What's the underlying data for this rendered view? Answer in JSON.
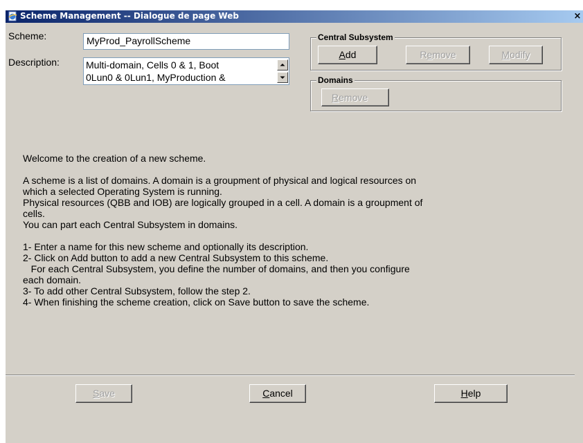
{
  "window": {
    "title": "Scheme Management -- Dialogue de page Web",
    "close_glyph": "×"
  },
  "form": {
    "scheme_label": "Scheme:",
    "scheme_value": "MyProd_PayrollScheme",
    "description_label": "Description:",
    "description_line1": "Multi-domain, Cells 0 & 1, Boot",
    "description_line2": "0Lun0 & 0Lun1, MyProduction &"
  },
  "central_subsystem": {
    "title": "Central Subsystem",
    "add_accel": "A",
    "add_rest": "dd",
    "remove_pre": "R",
    "remove_accel": "e",
    "remove_rest": "move",
    "modify_accel": "M",
    "modify_rest": "odify"
  },
  "domains": {
    "title": "Domains",
    "remove_accel": "R",
    "remove_rest": "emove"
  },
  "intro": {
    "welcome": "Welcome to the creation of a new scheme.",
    "p1": "A scheme is a list of domains. A domain is a groupment of physical and logical resources on",
    "p2": "which a selected Operating System is running.",
    "p3": "Physical resources (QBB and IOB) are logically grouped in a cell. A domain is a groupment of",
    "p4": "cells.",
    "p5": "You can part each Central Subsystem in domains.",
    "s1": "1- Enter a name for this new scheme and optionally its description.",
    "s2": "2- Click on Add button to add a new Central Subsystem to this scheme.",
    "s3": "   For each Central Subsystem, you define the number of domains, and then you configure",
    "s4": "each domain.",
    "s5": "3- To add other Central Subsystem, follow the step 2.",
    "s6": "4- When finishing the scheme creation, click on Save button to save the scheme."
  },
  "footer": {
    "save_accel": "S",
    "save_rest": "ave",
    "cancel_accel": "C",
    "cancel_rest": "ancel",
    "help_accel": "H",
    "help_rest": "elp"
  },
  "icons": {
    "title": "ie-page-icon",
    "scroll_up": "arrow-up-icon",
    "scroll_down": "arrow-down-icon"
  }
}
